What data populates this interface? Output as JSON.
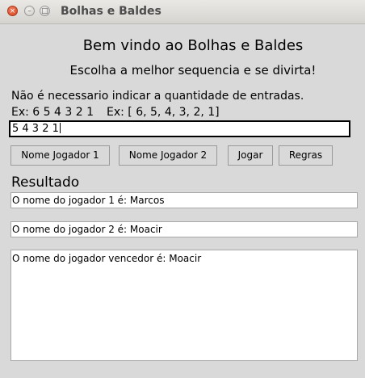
{
  "window": {
    "title": "Bolhas e Baldes",
    "close_glyph": "×",
    "minimize_glyph": "–",
    "maximize_glyph": "□"
  },
  "header": {
    "welcome": "Bem vindo ao Bolhas e Baldes",
    "subtitle": "Escolha a melhor sequencia e se divirta!"
  },
  "instructions": {
    "line1": "Não é necessario indicar a quantidade de entradas.",
    "example1": "Ex: 6 5 4 3 2 1",
    "example2": "Ex: [ 6, 5, 4, 3, 2, 1]"
  },
  "sequence_input": {
    "value": "5 4 3 2 1"
  },
  "buttons": {
    "player1": "Nome Jogador 1",
    "player2": "Nome Jogador 2",
    "play": "Jogar",
    "rules": "Regras"
  },
  "result": {
    "heading": "Resultado",
    "player1_text": "O nome do jogador 1 é: Marcos",
    "player2_text": "O nome do jogador 2 é: Moacir",
    "winner_text": "O nome do jogador vencedor é: Moacir"
  }
}
